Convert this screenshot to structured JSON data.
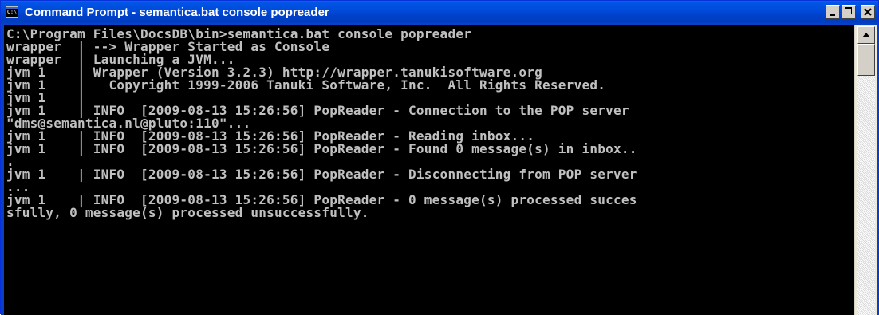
{
  "window": {
    "title": "Command Prompt - semantica.bat console popreader",
    "icon": "cmd-icon",
    "icon_label": "C:\\"
  },
  "controls": {
    "minimize": "minimize-icon",
    "maximize": "maximize-icon",
    "close": "close-icon"
  },
  "colors": {
    "titlebar": "#0a4fd8",
    "console_bg": "#000000",
    "console_text": "#c0c0c0"
  },
  "console": {
    "lines": [
      "C:\\Program Files\\DocsDB\\bin>semantica.bat console popreader",
      "wrapper  | --> Wrapper Started as Console",
      "wrapper  | Launching a JVM...",
      "jvm 1    | Wrapper (Version 3.2.3) http://wrapper.tanukisoftware.org",
      "jvm 1    |   Copyright 1999-2006 Tanuki Software, Inc.  All Rights Reserved.",
      "jvm 1    |",
      "jvm 1    | INFO  [2009-08-13 15:26:56] PopReader - Connection to the POP server",
      "\"dms@semantica.nl@pluto:110\"...",
      "jvm 1    | INFO  [2009-08-13 15:26:56] PopReader - Reading inbox...",
      "jvm 1    | INFO  [2009-08-13 15:26:56] PopReader - Found 0 message(s) in inbox..",
      ".",
      "jvm 1    | INFO  [2009-08-13 15:26:56] PopReader - Disconnecting from POP server",
      "...",
      "jvm 1    | INFO  [2009-08-13 15:26:56] PopReader - 0 message(s) processed succes",
      "sfully, 0 message(s) processed unsuccessfully."
    ]
  },
  "scrollbar": {
    "up_arrow": "scroll-up-arrow-icon"
  }
}
